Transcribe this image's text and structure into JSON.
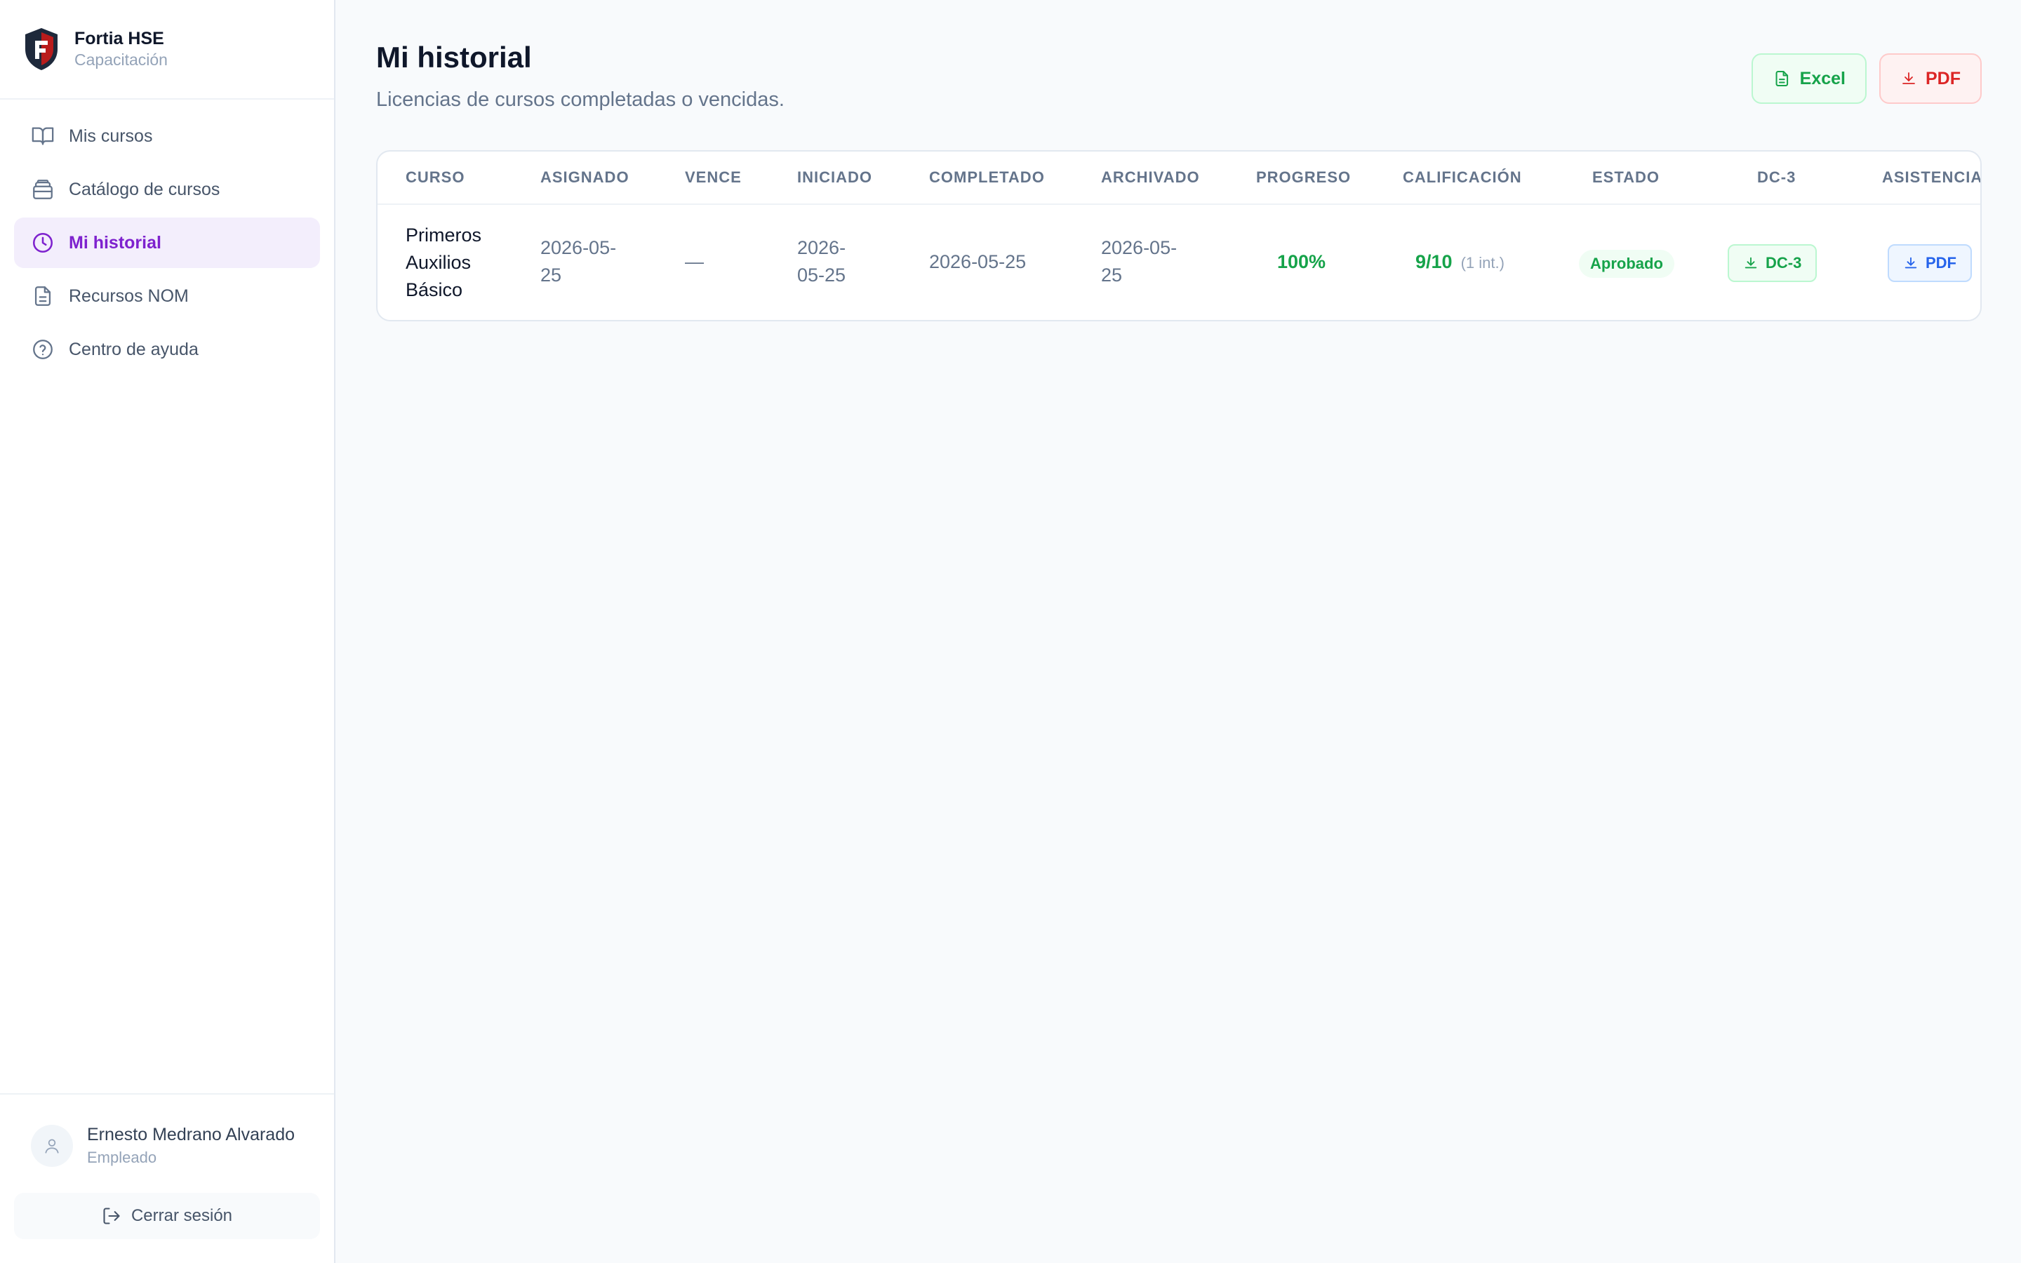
{
  "brand": {
    "name": "Fortia HSE",
    "subtitle": "Capacitación"
  },
  "sidebar": {
    "items": [
      {
        "label": "Mis cursos",
        "icon": "book-open-icon",
        "active": false
      },
      {
        "label": "Catálogo de cursos",
        "icon": "library-icon",
        "active": false
      },
      {
        "label": "Mi historial",
        "icon": "clock-icon",
        "active": true
      },
      {
        "label": "Recursos NOM",
        "icon": "file-text-icon",
        "active": false
      },
      {
        "label": "Centro de ayuda",
        "icon": "help-circle-icon",
        "active": false
      }
    ]
  },
  "user": {
    "name": "Ernesto Medrano Alvarado",
    "role": "Empleado",
    "logout_label": "Cerrar sesión"
  },
  "page": {
    "title": "Mi historial",
    "subtitle": "Licencias de cursos completadas o vencidas.",
    "export_excel_label": "Excel",
    "export_pdf_label": "PDF"
  },
  "table": {
    "headers": [
      "CURSO",
      "ASIGNADO",
      "VENCE",
      "INICIADO",
      "COMPLETADO",
      "ARCHIVADO",
      "PROGRESO",
      "CALIFICACIÓN",
      "ESTADO",
      "DC-3",
      "ASISTENCIA"
    ],
    "rows": [
      {
        "course": [
          "Primeros",
          "Auxilios",
          "Básico"
        ],
        "assigned": [
          "2026-05-",
          "25"
        ],
        "expires": "—",
        "started": [
          "2026-",
          "05-25"
        ],
        "completed": "2026-05-25",
        "archived": [
          "2026-05-",
          "25"
        ],
        "progress": "100%",
        "grade": "9/10",
        "attempts": "(1 int.)",
        "status": "Aprobado",
        "dc3_label": "DC-3",
        "attendance_label": "PDF"
      }
    ]
  },
  "colors": {
    "accent": "#7e22ce",
    "success": "#16a34a",
    "danger": "#dc2626",
    "info": "#2563eb"
  }
}
